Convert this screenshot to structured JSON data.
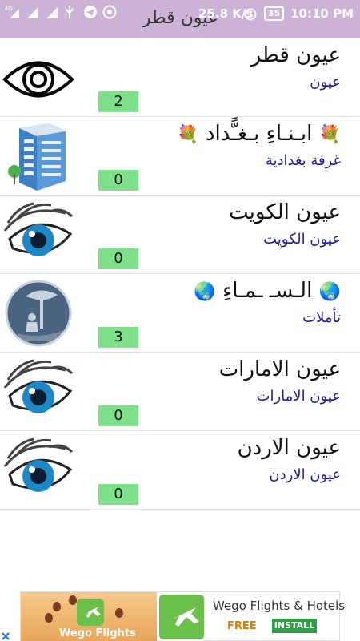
{
  "statusbar": {
    "network_type": "4G",
    "speed": "25.8 K/s",
    "battery": "35",
    "time": "10:10 PM"
  },
  "app": {
    "title": "عيون قطر"
  },
  "rooms": [
    {
      "title": "عيون قطر",
      "subtitle": "عيون",
      "count": "2",
      "icon": "eye-icon"
    },
    {
      "title": "ابـنـاءِ بـغـًّداد",
      "subtitle": "غرفة بغدادية",
      "count": "0",
      "icon": "building-icon",
      "emoji": "💐"
    },
    {
      "title": "عيون الكويت",
      "subtitle": "عيون الكويت",
      "count": "0",
      "icon": "lashes-eye-icon"
    },
    {
      "title": "الـسـ ـمـاءِ",
      "subtitle": "تأملات",
      "count": "3",
      "icon": "reading-tree-icon",
      "emoji": "🌏"
    },
    {
      "title": "عيون الامارات",
      "subtitle": "عيون الامارات",
      "count": "0",
      "icon": "lashes-eye-icon"
    },
    {
      "title": "عيون الاردن",
      "subtitle": "عيون الاردن",
      "count": "0",
      "icon": "lashes-eye-icon"
    }
  ],
  "ad": {
    "left_caption": "Wego Flights",
    "title": "Wego Flights & Hotels",
    "price": "FREE",
    "install_label": "INSTALL"
  }
}
